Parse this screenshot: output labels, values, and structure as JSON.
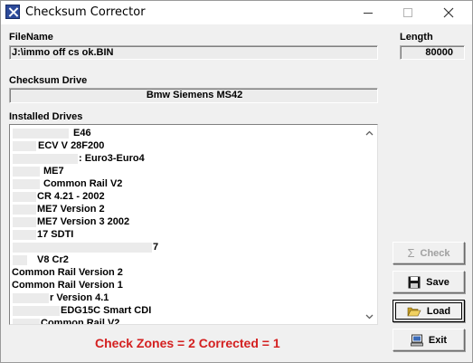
{
  "window": {
    "title": "Checksum Corrector",
    "minimize_glyph": "—",
    "maximize_glyph": "☐",
    "close_glyph": "✕"
  },
  "file": {
    "label": "FileName",
    "value": "J:\\immo off cs ok.BIN"
  },
  "length": {
    "label": "Length",
    "value": "80000"
  },
  "checksum_drive": {
    "label": "Checksum Drive",
    "value": "Bmw Siemens MS42"
  },
  "installed_drives": {
    "label": "Installed Drives",
    "items": [
      "E46",
      "ECV V 28F200",
      ": Euro3-Euro4",
      "ME7",
      "Common Rail V2",
      "CR 4.21 - 2002",
      "ME7 Version 2",
      "ME7 Version 3 2002",
      "17 SDTI",
      "7",
      "V8 Cr2",
      "Common Rail Version 2",
      "Common Rail Version 1",
      "r Version 4.1",
      "EDG15C Smart CDI",
      "Common Rail V2"
    ]
  },
  "status": {
    "text": "Check Zones = 2 Corrected = 1",
    "color": "#d42020"
  },
  "buttons": {
    "check": "Check",
    "save": "Save",
    "load": "Load",
    "exit": "Exit"
  },
  "icons": {
    "app": "checksum-app-icon",
    "check": "sigma-icon",
    "save": "floppy-disk-icon",
    "load": "open-folder-icon",
    "exit": "computer-exit-icon"
  }
}
